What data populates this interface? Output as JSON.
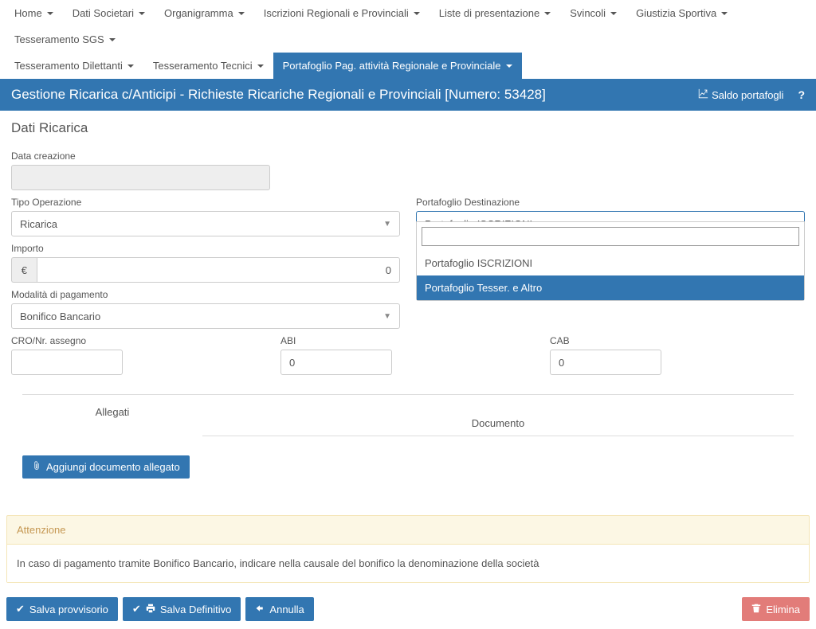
{
  "nav": {
    "row1": [
      "Home",
      "Dati Societari",
      "Organigramma",
      "Iscrizioni Regionali e Provinciali",
      "Liste di presentazione",
      "Svincoli",
      "Giustizia Sportiva",
      "Tesseramento SGS"
    ],
    "row2": [
      "Tesseramento Dilettanti",
      "Tesseramento Tecnici",
      "Portafoglio Pag. attività Regionale e Provinciale"
    ]
  },
  "titlebar": {
    "title": "Gestione Ricarica c/Anticipi - Richieste Ricariche Regionali e Provinciali [Numero: 53428]",
    "saldo": "Saldo portafogli",
    "help": "?"
  },
  "section": {
    "title": "Dati Ricarica"
  },
  "labels": {
    "data_creazione": "Data creazione",
    "tipo_operazione": "Tipo Operazione",
    "portafoglio_dest": "Portafoglio Destinazione",
    "importo": "Importo",
    "modalita": "Modalità di pagamento",
    "cro": "CRO/Nr. assegno",
    "abi": "ABI",
    "cab": "CAB"
  },
  "values": {
    "tipo_operazione": "Ricarica",
    "portafoglio_selected": "Portafoglio ISCRIZIONI",
    "importo": "0",
    "euro": "€",
    "modalita": "Bonifico Bancario",
    "cro": "",
    "abi": "0",
    "cab": "0",
    "dd_search": ""
  },
  "dropdown_options": [
    "Portafoglio ISCRIZIONI",
    "Portafoglio Tesser. e Altro"
  ],
  "allegati": {
    "label": "Allegati",
    "doc": "Documento",
    "add": "Aggiungi documento allegato"
  },
  "alert": {
    "title": "Attenzione",
    "body": "In caso di pagamento tramite Bonifico Bancario, indicare nella causale del bonifico la denominazione della società"
  },
  "buttons": {
    "save_prov": "Salva provvisorio",
    "save_def": "Salva Definitivo",
    "annulla": "Annulla",
    "elimina": "Elimina"
  }
}
